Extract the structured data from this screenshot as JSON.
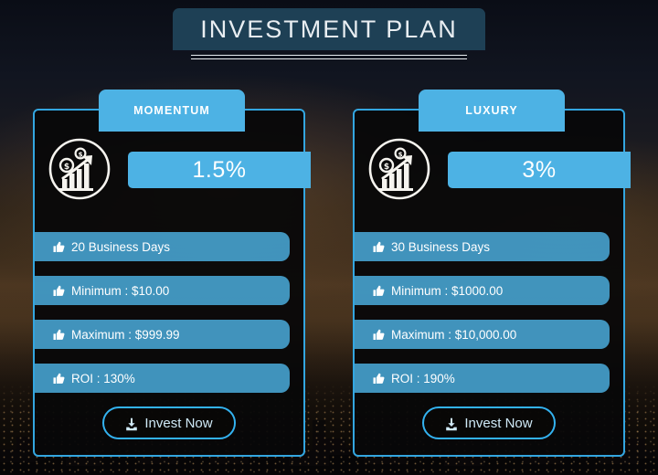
{
  "page": {
    "title": "INVESTMENT PLAN"
  },
  "theme": {
    "accent_blue": "#4db2e4",
    "border_blue": "#33a6e0",
    "title_banner_bg": "#1e4055",
    "text_white": "#ffffff",
    "button_text": "#cfe9f7"
  },
  "icons": {
    "plan": "growth-chart-icon",
    "feature_bullet": "thumbs-up-icon",
    "invest_button": "download-icon"
  },
  "plans": [
    {
      "name": "MOMENTUM",
      "rate": "1.5%",
      "features": [
        "20 Business Days",
        "Minimum : $10.00",
        "Maximum : $999.99",
        "ROI : 130%"
      ],
      "cta": "Invest Now"
    },
    {
      "name": "LUXURY",
      "rate": "3%",
      "features": [
        "30 Business Days",
        "Minimum : $1000.00",
        "Maximum : $10,000.00",
        "ROI : 190%"
      ],
      "cta": "Invest Now"
    }
  ]
}
